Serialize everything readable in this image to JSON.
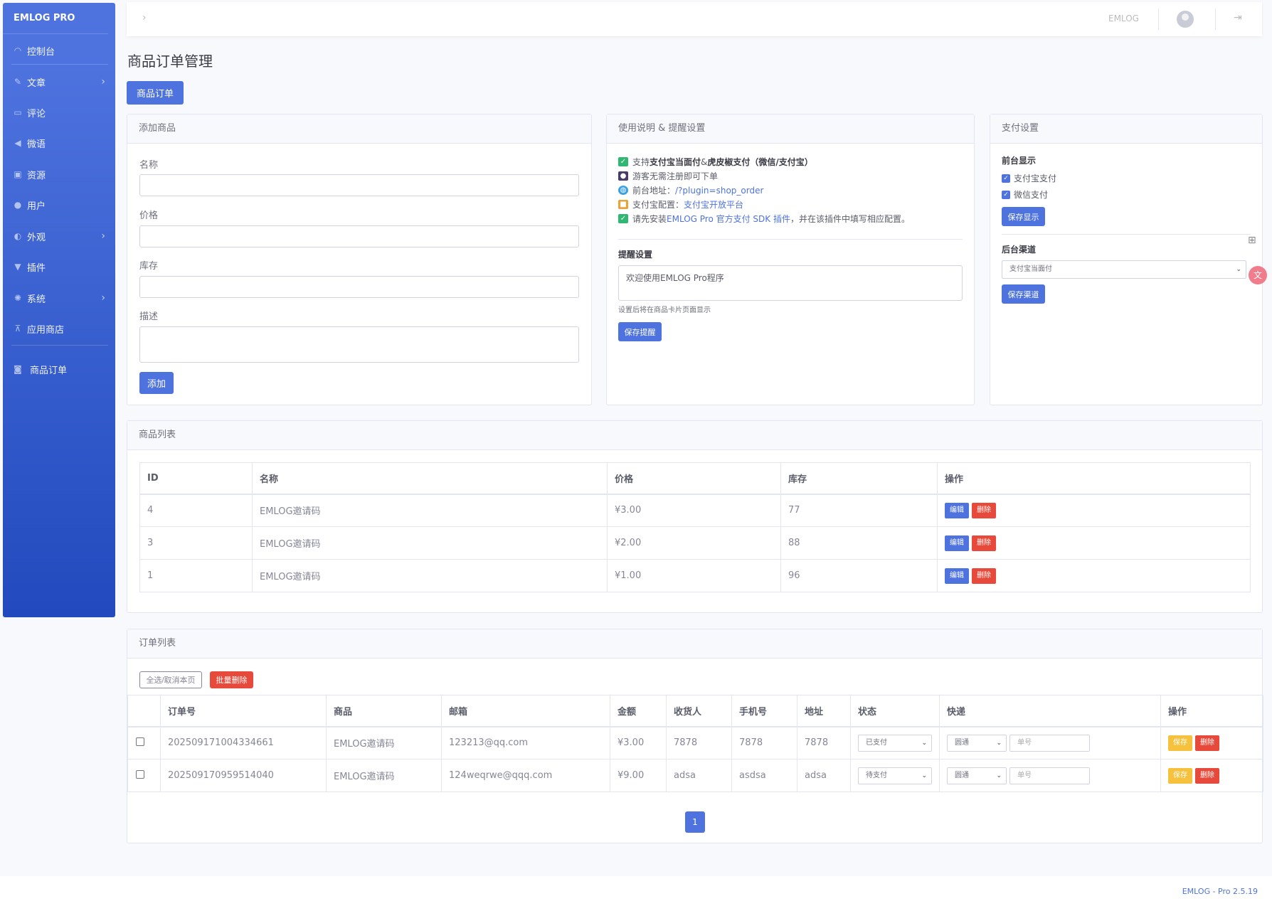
{
  "sidebar": {
    "brand": "EMLOG PRO",
    "items": [
      {
        "label": "控制台",
        "icon": "dashboard-icon",
        "arrow": ""
      },
      {
        "label": "文章",
        "icon": "pencil-icon",
        "arrow": "›"
      },
      {
        "label": "评论",
        "icon": "comment-icon",
        "arrow": ""
      },
      {
        "label": "微语",
        "icon": "megaphone-icon",
        "arrow": ""
      },
      {
        "label": "资源",
        "icon": "image-icon",
        "arrow": ""
      },
      {
        "label": "用户",
        "icon": "user-icon",
        "arrow": ""
      },
      {
        "label": "外观",
        "icon": "palette-icon",
        "arrow": "›"
      },
      {
        "label": "插件",
        "icon": "plug-icon",
        "arrow": ""
      },
      {
        "label": "系统",
        "icon": "gear-icon",
        "arrow": "›"
      },
      {
        "label": "应用商店",
        "icon": "cart-icon",
        "arrow": ""
      },
      {
        "label": "商品订单",
        "icon": "money-icon",
        "arrow": ""
      }
    ]
  },
  "topbar": {
    "user_name": "EMLOG",
    "toggle": "›",
    "logout": "⇥"
  },
  "page": {
    "title": "商品订单管理",
    "tab": "商品订单"
  },
  "add_product": {
    "header": "添加商品",
    "name_label": "名称",
    "price_label": "价格",
    "stock_label": "库存",
    "desc_label": "描述",
    "submit": "添加"
  },
  "usage": {
    "header": "使用说明 & 提醒设置",
    "line1_pre": "支持 ",
    "line1_b1": "支付宝当面付",
    "line1_mid": " & ",
    "line1_b2": "虎皮椒支付（微信/支付宝）",
    "line2": "游客无需注册即可下单",
    "line3_pre": "前台地址：",
    "line3_link": "/?plugin=shop_order",
    "line4_pre": "支付宝配置：",
    "line4_link": "支付宝开放平台",
    "line5_pre": "请先安装 ",
    "line5_link": "EMLOG Pro 官方支付 SDK 插件",
    "line5_post": "，并在该插件中填写相应配置。",
    "remind_title": "提醒设置",
    "remind_value": "欢迎使用EMLOG Pro程序",
    "remind_hint": "设置后将在商品卡片页面显示",
    "save_remind": "保存提醒"
  },
  "pay_settings": {
    "header": "支付设置",
    "front_title": "前台显示",
    "opt_alipay": "支付宝支付",
    "opt_wechat": "微信支付",
    "save_display": "保存显示",
    "back_title": "后台渠道",
    "channel": "支付宝当面付",
    "save_channel": "保存渠道"
  },
  "product_list": {
    "header": "商品列表",
    "columns": [
      "ID",
      "名称",
      "价格",
      "库存",
      "操作"
    ],
    "edit": "编辑",
    "delete": "删除",
    "rows": [
      {
        "id": "4",
        "name": "EMLOG邀请码",
        "price": "¥3.00",
        "stock": "77"
      },
      {
        "id": "3",
        "name": "EMLOG邀请码",
        "price": "¥2.00",
        "stock": "88"
      },
      {
        "id": "1",
        "name": "EMLOG邀请码",
        "price": "¥1.00",
        "stock": "96"
      }
    ]
  },
  "order_list": {
    "header": "订单列表",
    "select_all": "全选/取消本页",
    "batch_delete": "批量删除",
    "columns": [
      "",
      "订单号",
      "商品",
      "邮箱",
      "金额",
      "收货人",
      "手机号",
      "地址",
      "状态",
      "快递",
      "操作"
    ],
    "save": "保存",
    "delete": "删除",
    "tracking_placeholder": "单号",
    "rows": [
      {
        "order_no": "2025091710043346​61",
        "product": "EMLOG邀请码",
        "email": "123213@qq.com",
        "amount": "¥3.00",
        "receiver": "7878",
        "phone": "7878",
        "address": "7878",
        "status": "已支付",
        "courier": "圆通"
      },
      {
        "order_no": "202509170959514040",
        "product": "EMLOG邀请码",
        "email": "124weqrwe@qqq.com",
        "amount": "¥9.00",
        "receiver": "adsa",
        "phone": "asdsa",
        "address": "adsa",
        "status": "待支付",
        "courier": "圆通"
      }
    ],
    "page": "1"
  },
  "footer": {
    "version": "EMLOG - Pro 2.5.19"
  },
  "colors": {
    "primary": "#4e73df",
    "danger": "#e74a3b",
    "warning": "#f6c23e"
  }
}
